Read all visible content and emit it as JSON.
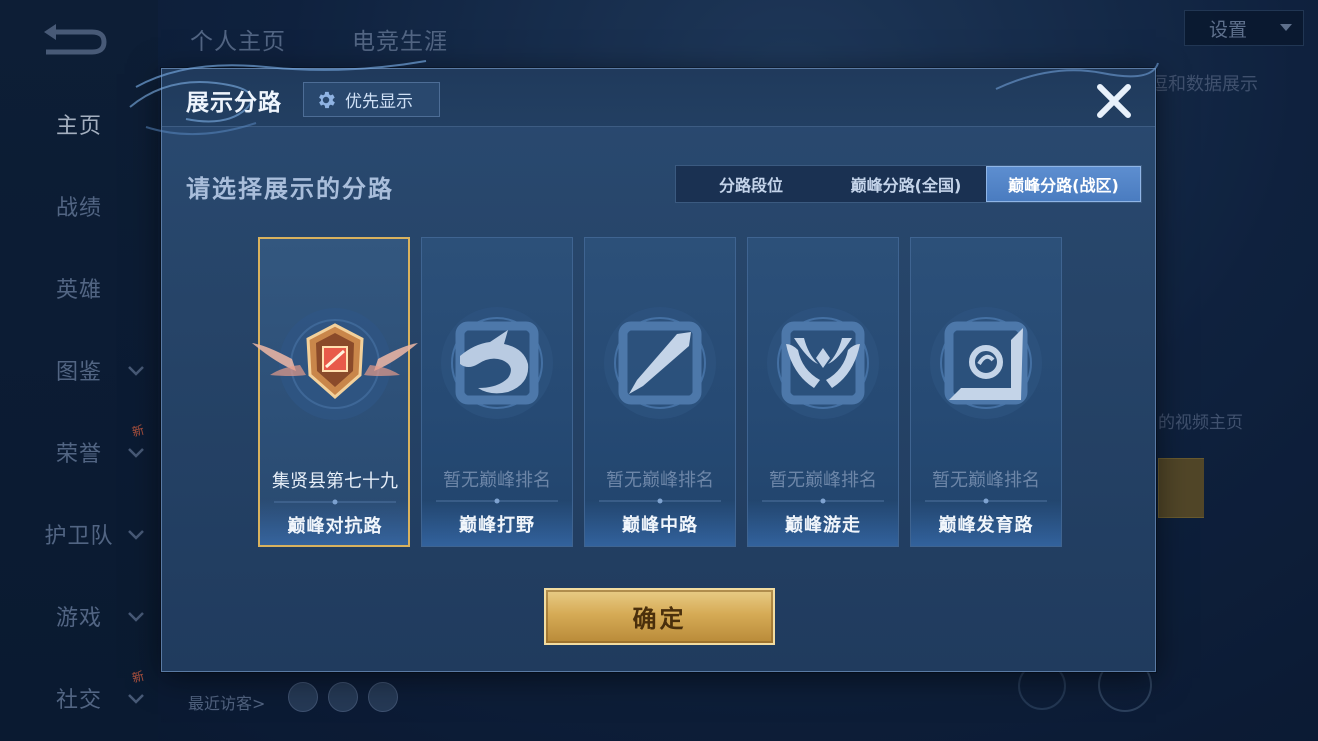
{
  "background": {
    "sidebar": [
      {
        "label": "主页",
        "active": true,
        "chevron": false,
        "new": false
      },
      {
        "label": "战绩",
        "active": false,
        "chevron": false,
        "new": false
      },
      {
        "label": "英雄",
        "active": false,
        "chevron": false,
        "new": false
      },
      {
        "label": "图鉴",
        "active": false,
        "chevron": true,
        "new": false
      },
      {
        "label": "荣誉",
        "active": false,
        "chevron": true,
        "new": true
      },
      {
        "label": "护卫队",
        "active": false,
        "chevron": true,
        "new": false
      },
      {
        "label": "游戏",
        "active": false,
        "chevron": true,
        "new": false
      },
      {
        "label": "社交",
        "active": false,
        "chevron": true,
        "new": true
      }
    ],
    "new_badge": "新",
    "top_tabs": [
      "个人主页",
      "电竞生涯"
    ],
    "settings_label": "设置",
    "right_text_1": "逗和数据展示",
    "right_text_2": "的视频主页",
    "recent_visitors_label": "最近访客>"
  },
  "modal": {
    "title": "展示分路",
    "priority_label": "优先显示",
    "subtitle": "请选择展示的分路",
    "tabs": [
      {
        "label": "分路段位",
        "active": false
      },
      {
        "label": "巅峰分路(全国)",
        "active": false
      },
      {
        "label": "巅峰分路(战区)",
        "active": true
      }
    ],
    "cards": [
      {
        "rank": "集贤县第七十九",
        "lane": "巅峰对抗路",
        "icon": "clash-lane-badge-icon",
        "selected": true
      },
      {
        "rank": "暂无巅峰排名",
        "lane": "巅峰打野",
        "icon": "jungle-dragon-icon",
        "selected": false
      },
      {
        "rank": "暂无巅峰排名",
        "lane": "巅峰中路",
        "icon": "mid-lane-icon",
        "selected": false
      },
      {
        "rank": "暂无巅峰排名",
        "lane": "巅峰游走",
        "icon": "roam-wings-icon",
        "selected": false
      },
      {
        "rank": "暂无巅峰排名",
        "lane": "巅峰发育路",
        "icon": "farm-lane-icon",
        "selected": false
      }
    ],
    "confirm_label": "确定"
  },
  "colors": {
    "accent_gold": "#d9b25e",
    "active_tab_blue": "#5d8ed0",
    "modal_bg": "#264468"
  }
}
